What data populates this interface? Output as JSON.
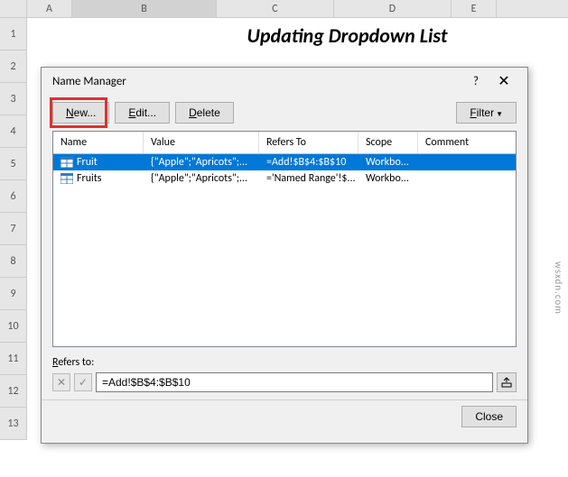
{
  "columns": [
    "A",
    "B",
    "C",
    "D",
    "E"
  ],
  "rows": [
    "1",
    "2",
    "3",
    "4",
    "5",
    "6",
    "7",
    "8",
    "9",
    "10",
    "11",
    "12",
    "13"
  ],
  "title_cell": "Updating Dropdown List",
  "dialog": {
    "title": "Name Manager",
    "help": "?",
    "close": "✕",
    "buttons": {
      "new": "New...",
      "edit": "Edit...",
      "delete": "Delete",
      "filter": "Filter",
      "close_btn": "Close"
    },
    "headers": {
      "name": "Name",
      "value": "Value",
      "refers": "Refers To",
      "scope": "Scope",
      "comment": "Comment"
    },
    "items": [
      {
        "name": "Fruit",
        "value": "{\"Apple\";\"Apricots\";...",
        "refers": "=Add!$B$4:$B$10",
        "scope": "Workbo...",
        "comment": ""
      },
      {
        "name": "Fruits",
        "value": "{\"Apple\";\"Apricots\";...",
        "refers": "='Named Range'!$...",
        "scope": "Workbo...",
        "comment": ""
      }
    ],
    "refers_label": "Refers to:",
    "refers_value": "=Add!$B$4:$B$10"
  },
  "watermark": "wsxdn.com"
}
